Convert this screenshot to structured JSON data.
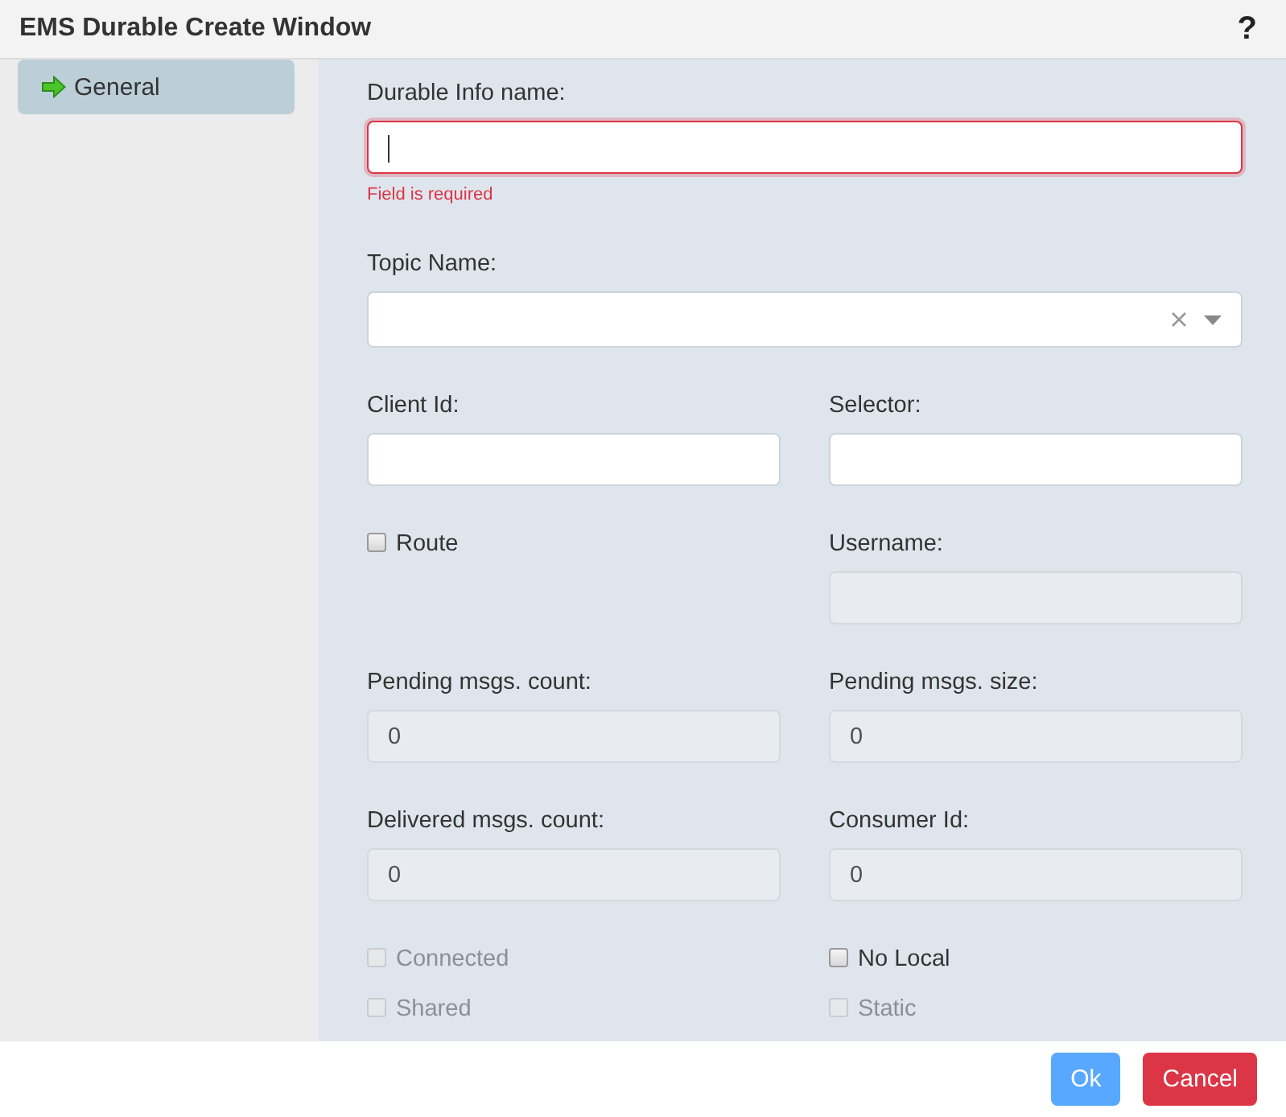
{
  "window": {
    "title": "EMS Durable Create Window",
    "help": "?"
  },
  "sidebar": {
    "items": [
      {
        "label": "General",
        "selected": true
      }
    ]
  },
  "form": {
    "rows": [
      {
        "cells": [
          {
            "kind": "text",
            "label": "Durable Info name:",
            "focused": true,
            "disabled": false,
            "error": "Field is required"
          }
        ]
      },
      {
        "cells": [
          {
            "kind": "select",
            "label": "Topic Name:",
            "disabled": false
          }
        ]
      },
      {
        "cells": [
          {
            "kind": "text",
            "label": "Client Id:",
            "focused": false,
            "disabled": false
          },
          {
            "kind": "text",
            "label": "Selector:",
            "focused": false,
            "disabled": false
          }
        ]
      },
      {
        "cells": [
          {
            "kind": "checkbox",
            "label": "Route",
            "checked": false,
            "disabled": false
          },
          {
            "kind": "text",
            "label": "Username:",
            "focused": false,
            "disabled": true
          }
        ]
      },
      {
        "cells": [
          {
            "kind": "text",
            "label": "Pending msgs. count:",
            "value": "0",
            "focused": false,
            "disabled": true
          },
          {
            "kind": "text",
            "label": "Pending msgs. size:",
            "value": "0",
            "focused": false,
            "disabled": true
          }
        ]
      },
      {
        "cells": [
          {
            "kind": "text",
            "label": "Delivered msgs. count:",
            "value": "0",
            "focused": false,
            "disabled": true
          },
          {
            "kind": "text",
            "label": "Consumer Id:",
            "value": "0",
            "focused": false,
            "disabled": true
          }
        ]
      },
      {
        "cells": [
          {
            "kind": "checkbox",
            "label": "Connected",
            "checked": false,
            "disabled": true
          },
          {
            "kind": "checkbox",
            "label": "No Local",
            "checked": false,
            "disabled": false
          }
        ]
      },
      {
        "cells": [
          {
            "kind": "checkbox",
            "label": "Shared",
            "checked": false,
            "disabled": true
          },
          {
            "kind": "checkbox",
            "label": "Static",
            "checked": false,
            "disabled": true
          }
        ]
      }
    ]
  },
  "buttons": [
    {
      "label": "Ok",
      "kind": "primary",
      "disabled": true
    },
    {
      "label": "Cancel",
      "kind": "danger",
      "disabled": false
    }
  ]
}
